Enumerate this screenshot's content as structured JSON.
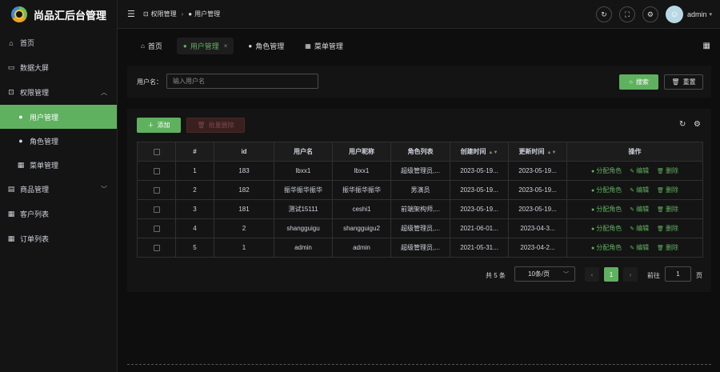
{
  "app": {
    "title": "尚品汇后台管理"
  },
  "sidebar": {
    "items": [
      {
        "label": "首页",
        "icon": "home-icon"
      },
      {
        "label": "数据大屏",
        "icon": "screen-icon"
      },
      {
        "label": "权限管理",
        "icon": "lock-icon",
        "expanded": true
      },
      {
        "label": "用户管理",
        "icon": "user-icon",
        "active": true
      },
      {
        "label": "角色管理",
        "icon": "user-icon"
      },
      {
        "label": "菜单管理",
        "icon": "grid-icon"
      },
      {
        "label": "商品管理",
        "icon": "goods-icon",
        "expanded": false
      },
      {
        "label": "客户列表",
        "icon": "list-icon"
      },
      {
        "label": "订单列表",
        "icon": "list-icon"
      }
    ]
  },
  "header": {
    "breadcrumb": [
      "权限管理",
      "用户管理"
    ],
    "user_name": "admin"
  },
  "tabs": [
    {
      "label": "首页",
      "active": false
    },
    {
      "label": "用户管理",
      "active": true,
      "close": "×"
    },
    {
      "label": "角色管理",
      "active": false
    },
    {
      "label": "菜单管理",
      "active": false
    }
  ],
  "search": {
    "label": "用户名：",
    "placeholder": "输入用户名",
    "search_label": "搜索",
    "reset_label": "重置"
  },
  "toolbar": {
    "add_label": "添加",
    "batch_delete_label": "批量删除"
  },
  "table": {
    "columns": [
      "#",
      "id",
      "用户名",
      "用户昵称",
      "角色列表",
      "创建时间",
      "更新时间",
      "操作"
    ],
    "rows": [
      {
        "index": "1",
        "id": "183",
        "username": "lbxx1",
        "nickname": "lbxx1",
        "roles": "超级管理员,...",
        "created": "2023-05-19...",
        "updated": "2023-05-19..."
      },
      {
        "index": "2",
        "id": "182",
        "username": "振华振华振华",
        "nickname": "振华振华振华",
        "roles": "男演员",
        "created": "2023-05-19...",
        "updated": "2023-05-19..."
      },
      {
        "index": "3",
        "id": "181",
        "username": "测试15111",
        "nickname": "ceshi1",
        "roles": "前端架构师,...",
        "created": "2023-05-19...",
        "updated": "2023-05-19..."
      },
      {
        "index": "4",
        "id": "2",
        "username": "shangguigu",
        "nickname": "shangguigu2",
        "roles": "超级管理员,...",
        "created": "2021-06-01...",
        "updated": "2023-04-3..."
      },
      {
        "index": "5",
        "id": "1",
        "username": "admin",
        "nickname": "admin",
        "roles": "超级管理员,...",
        "created": "2021-05-31...",
        "updated": "2023-04-2..."
      }
    ],
    "actions": {
      "assign": "分配角色",
      "edit": "编辑",
      "delete": "删除"
    }
  },
  "pagination": {
    "total_text": "共 5 条",
    "page_size": "10条/页",
    "current_page": "1",
    "goto_label": "前往",
    "goto_value": "1",
    "page_suffix": "页"
  },
  "colors": {
    "accent": "#5fb15f",
    "background": "#0e0e0e",
    "card": "#141414"
  }
}
